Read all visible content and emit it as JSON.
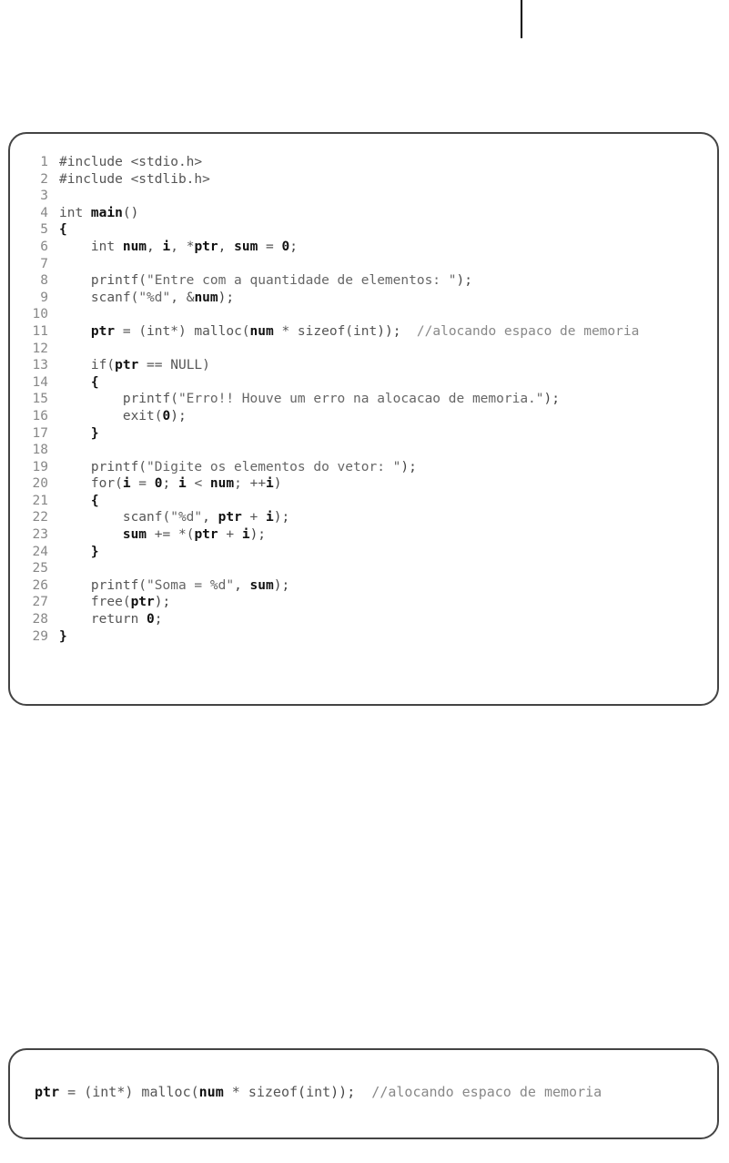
{
  "box1": {
    "lines": [
      {
        "n": "1",
        "tokens": [
          {
            "t": "#include <stdio.h>",
            "c": "kw"
          }
        ]
      },
      {
        "n": "2",
        "tokens": [
          {
            "t": "#include <stdlib.h>",
            "c": "kw"
          }
        ]
      },
      {
        "n": "3",
        "tokens": [
          {
            "t": "",
            "c": ""
          }
        ]
      },
      {
        "n": "4",
        "tokens": [
          {
            "t": "int ",
            "c": "kw"
          },
          {
            "t": "main",
            "c": "bold"
          },
          {
            "t": "()",
            "c": "punct"
          }
        ]
      },
      {
        "n": "5",
        "tokens": [
          {
            "t": "{",
            "c": "bold"
          }
        ]
      },
      {
        "n": "6",
        "tokens": [
          {
            "t": "    int ",
            "c": "kw"
          },
          {
            "t": "num",
            "c": "bold"
          },
          {
            "t": ", ",
            "c": "punct"
          },
          {
            "t": "i",
            "c": "bold"
          },
          {
            "t": ", *",
            "c": "kw"
          },
          {
            "t": "ptr",
            "c": "bold"
          },
          {
            "t": ", ",
            "c": "punct"
          },
          {
            "t": "sum",
            "c": "bold"
          },
          {
            "t": " = ",
            "c": "kw"
          },
          {
            "t": "0",
            "c": "bold"
          },
          {
            "t": ";",
            "c": "punct"
          }
        ]
      },
      {
        "n": "7",
        "tokens": [
          {
            "t": "",
            "c": ""
          }
        ]
      },
      {
        "n": "8",
        "tokens": [
          {
            "t": "    printf(",
            "c": "kw"
          },
          {
            "t": "\"Entre com a quantidade de elementos: \"",
            "c": "str"
          },
          {
            "t": ");",
            "c": "punct"
          }
        ]
      },
      {
        "n": "9",
        "tokens": [
          {
            "t": "    scanf(",
            "c": "kw"
          },
          {
            "t": "\"%d\"",
            "c": "str"
          },
          {
            "t": ", &",
            "c": "kw"
          },
          {
            "t": "num",
            "c": "bold"
          },
          {
            "t": ");",
            "c": "punct"
          }
        ]
      },
      {
        "n": "10",
        "tokens": [
          {
            "t": "",
            "c": ""
          }
        ]
      },
      {
        "n": "11",
        "tokens": [
          {
            "t": "    ",
            "c": ""
          },
          {
            "t": "ptr",
            "c": "bold"
          },
          {
            "t": " = (int*) malloc(",
            "c": "kw"
          },
          {
            "t": "num",
            "c": "bold"
          },
          {
            "t": " * sizeof(int",
            "c": "kw"
          },
          {
            "t": "));",
            "c": "punct"
          },
          {
            "t": "  //alocando espaco de memoria",
            "c": "cmt"
          }
        ]
      },
      {
        "n": "12",
        "tokens": [
          {
            "t": "",
            "c": ""
          }
        ]
      },
      {
        "n": "13",
        "tokens": [
          {
            "t": "    if(",
            "c": "kw"
          },
          {
            "t": "ptr",
            "c": "bold"
          },
          {
            "t": " == NULL)",
            "c": "kw"
          }
        ]
      },
      {
        "n": "14",
        "tokens": [
          {
            "t": "    ",
            "c": ""
          },
          {
            "t": "{",
            "c": "bold"
          }
        ]
      },
      {
        "n": "15",
        "tokens": [
          {
            "t": "        printf(",
            "c": "kw"
          },
          {
            "t": "\"Erro!! Houve um erro na alocacao de memoria.\"",
            "c": "str"
          },
          {
            "t": ");",
            "c": "punct"
          }
        ]
      },
      {
        "n": "16",
        "tokens": [
          {
            "t": "        exit(",
            "c": "kw"
          },
          {
            "t": "0",
            "c": "bold"
          },
          {
            "t": ");",
            "c": "punct"
          }
        ]
      },
      {
        "n": "17",
        "tokens": [
          {
            "t": "    ",
            "c": ""
          },
          {
            "t": "}",
            "c": "bold"
          }
        ]
      },
      {
        "n": "18",
        "tokens": [
          {
            "t": "",
            "c": ""
          }
        ]
      },
      {
        "n": "19",
        "tokens": [
          {
            "t": "    printf(",
            "c": "kw"
          },
          {
            "t": "\"Digite os elementos do vetor: \"",
            "c": "str"
          },
          {
            "t": ");",
            "c": "punct"
          }
        ]
      },
      {
        "n": "20",
        "tokens": [
          {
            "t": "    for(",
            "c": "kw"
          },
          {
            "t": "i",
            "c": "bold"
          },
          {
            "t": " = ",
            "c": "kw"
          },
          {
            "t": "0",
            "c": "bold"
          },
          {
            "t": "; ",
            "c": "punct"
          },
          {
            "t": "i",
            "c": "bold"
          },
          {
            "t": " < ",
            "c": "kw"
          },
          {
            "t": "num",
            "c": "bold"
          },
          {
            "t": "; ++",
            "c": "kw"
          },
          {
            "t": "i",
            "c": "bold"
          },
          {
            "t": ")",
            "c": "punct"
          }
        ]
      },
      {
        "n": "21",
        "tokens": [
          {
            "t": "    ",
            "c": ""
          },
          {
            "t": "{",
            "c": "bold"
          }
        ]
      },
      {
        "n": "22",
        "tokens": [
          {
            "t": "        scanf(",
            "c": "kw"
          },
          {
            "t": "\"%d\"",
            "c": "str"
          },
          {
            "t": ", ",
            "c": "punct"
          },
          {
            "t": "ptr",
            "c": "bold"
          },
          {
            "t": " + ",
            "c": "kw"
          },
          {
            "t": "i",
            "c": "bold"
          },
          {
            "t": ");",
            "c": "punct"
          }
        ]
      },
      {
        "n": "23",
        "tokens": [
          {
            "t": "        ",
            "c": ""
          },
          {
            "t": "sum",
            "c": "bold"
          },
          {
            "t": " += *(",
            "c": "kw"
          },
          {
            "t": "ptr",
            "c": "bold"
          },
          {
            "t": " + ",
            "c": "kw"
          },
          {
            "t": "i",
            "c": "bold"
          },
          {
            "t": ");",
            "c": "punct"
          }
        ]
      },
      {
        "n": "24",
        "tokens": [
          {
            "t": "    ",
            "c": ""
          },
          {
            "t": "}",
            "c": "bold"
          }
        ]
      },
      {
        "n": "25",
        "tokens": [
          {
            "t": "",
            "c": ""
          }
        ]
      },
      {
        "n": "26",
        "tokens": [
          {
            "t": "    printf(",
            "c": "kw"
          },
          {
            "t": "\"Soma = %d\"",
            "c": "str"
          },
          {
            "t": ", ",
            "c": "punct"
          },
          {
            "t": "sum",
            "c": "bold"
          },
          {
            "t": ");",
            "c": "punct"
          }
        ]
      },
      {
        "n": "27",
        "tokens": [
          {
            "t": "    free(",
            "c": "kw"
          },
          {
            "t": "ptr",
            "c": "bold"
          },
          {
            "t": ");",
            "c": "punct"
          }
        ]
      },
      {
        "n": "28",
        "tokens": [
          {
            "t": "    return ",
            "c": "kw"
          },
          {
            "t": "0",
            "c": "bold"
          },
          {
            "t": ";",
            "c": "punct"
          }
        ]
      },
      {
        "n": "29",
        "tokens": [
          {
            "t": "}",
            "c": "bold"
          }
        ]
      }
    ]
  },
  "box2": {
    "tokens": [
      {
        "t": " ",
        "c": ""
      },
      {
        "t": "ptr",
        "c": "bold"
      },
      {
        "t": " = (",
        "c": "kw"
      },
      {
        "t": "int",
        "c": "kw"
      },
      {
        "t": "*) malloc(",
        "c": "kw"
      },
      {
        "t": "num",
        "c": "bold"
      },
      {
        "t": " * ",
        "c": "kw"
      },
      {
        "t": "sizeof",
        "c": "kw"
      },
      {
        "t": "(",
        "c": "punct"
      },
      {
        "t": "int",
        "c": "kw"
      },
      {
        "t": "));",
        "c": "punct"
      },
      {
        "t": "  //alocando espaco de memoria",
        "c": "cmt"
      }
    ]
  }
}
